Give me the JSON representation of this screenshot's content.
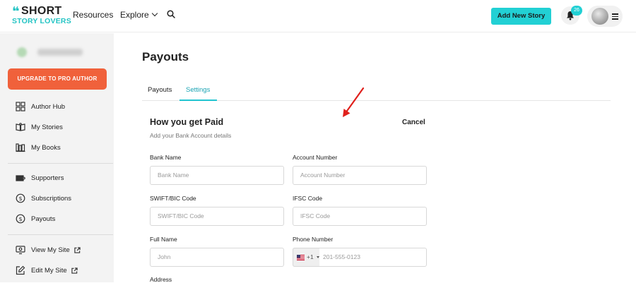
{
  "colors": {
    "accent": "#22d0d4",
    "upgrade": "#f0613b",
    "active_tab": "#1aa3b3",
    "arrow": "#e0201c"
  },
  "header": {
    "logo_line1": "SHORT",
    "logo_line2": "STORY LOVERS",
    "nav": {
      "resources": "Resources",
      "explore": "Explore"
    },
    "add_story_label": "Add New Story",
    "notification_count": "26"
  },
  "sidebar": {
    "upgrade_label": "UPGRADE TO PRO AUTHOR",
    "items": [
      {
        "label": "Author Hub",
        "icon": "grid-icon"
      },
      {
        "label": "My Stories",
        "icon": "book-open-icon"
      },
      {
        "label": "My Books",
        "icon": "books-icon"
      },
      {
        "label": "Supporters",
        "icon": "ticket-icon"
      },
      {
        "label": "Subscriptions",
        "icon": "dollar-circle-icon"
      },
      {
        "label": "Payouts",
        "icon": "dollar-circle-icon"
      },
      {
        "label": "View My Site",
        "icon": "monitor-icon"
      },
      {
        "label": "Edit My Site",
        "icon": "edit-icon"
      }
    ]
  },
  "main": {
    "title": "Payouts",
    "tabs": [
      {
        "label": "Payouts",
        "active": false
      },
      {
        "label": "Settings",
        "active": true
      }
    ],
    "section_title": "How you get Paid",
    "section_subtitle": "Add your Bank Account details",
    "cancel_label": "Cancel",
    "fields": {
      "bank_name": {
        "label": "Bank Name",
        "placeholder": "Bank Name"
      },
      "account_number": {
        "label": "Account Number",
        "placeholder": "Account Number"
      },
      "swift": {
        "label": "SWIFT/BIC Code",
        "placeholder": "SWIFT/BIC Code"
      },
      "ifsc": {
        "label": "IFSC Code",
        "placeholder": "IFSC Code"
      },
      "full_name": {
        "label": "Full Name",
        "placeholder": "John"
      },
      "phone": {
        "label": "Phone Number",
        "country_code": "+1",
        "placeholder": "201-555-0123"
      },
      "address": {
        "label": "Address"
      }
    }
  }
}
